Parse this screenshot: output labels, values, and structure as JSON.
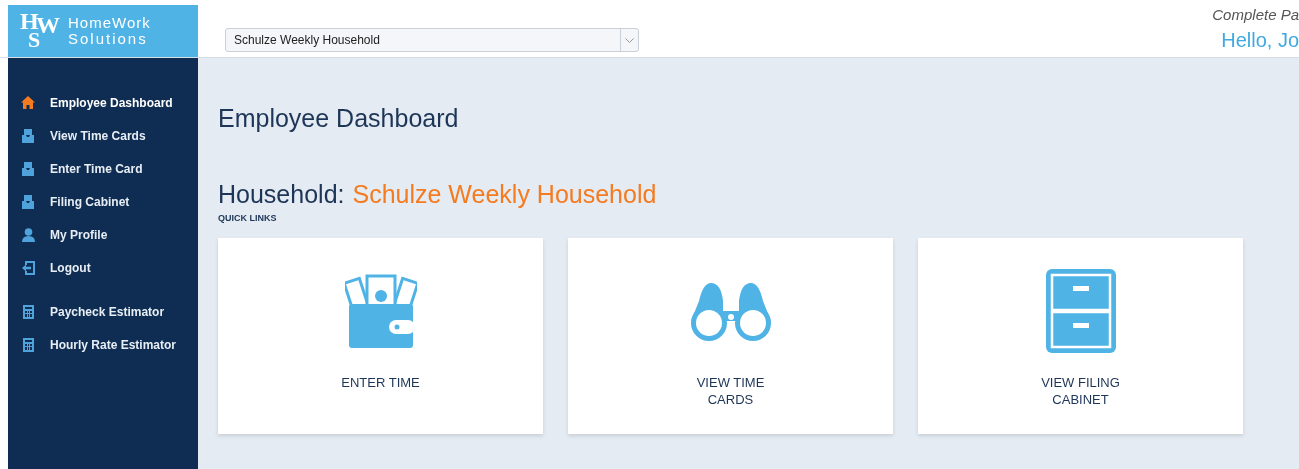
{
  "logo": {
    "mark_top": "H",
    "mark_mid": "W",
    "mark_bottom": "S",
    "line1": "HomeWork",
    "line2": "Solutions"
  },
  "household_select": {
    "value": "Schulze Weekly Household"
  },
  "header": {
    "notice": "Complete Pa",
    "greeting": "Hello, Jo"
  },
  "sidebar": {
    "items": [
      {
        "label": "Employee Dashboard",
        "kind": "home",
        "selected": true
      },
      {
        "label": "View Time Cards",
        "kind": "tray",
        "selected": false
      },
      {
        "label": "Enter Time Card",
        "kind": "tray",
        "selected": false
      },
      {
        "label": "Filing Cabinet",
        "kind": "tray",
        "selected": false
      },
      {
        "label": "My Profile",
        "kind": "user",
        "selected": false
      },
      {
        "label": "Logout",
        "kind": "logout",
        "selected": false
      },
      {
        "label": "Paycheck Estimator",
        "kind": "calculator",
        "selected": false,
        "group_start": true
      },
      {
        "label": "Hourly Rate Estimator",
        "kind": "calculator",
        "selected": false
      }
    ]
  },
  "page": {
    "title": "Employee Dashboard",
    "household_label": "Household:",
    "household_name": "Schulze Weekly Household",
    "section": "QUICK LINKS"
  },
  "quick_links": [
    {
      "label": "ENTER TIME",
      "kind": "wallet"
    },
    {
      "label": "VIEW TIME CARDS",
      "kind": "binoculars"
    },
    {
      "label": "VIEW FILING CABINET",
      "kind": "cabinet"
    }
  ]
}
